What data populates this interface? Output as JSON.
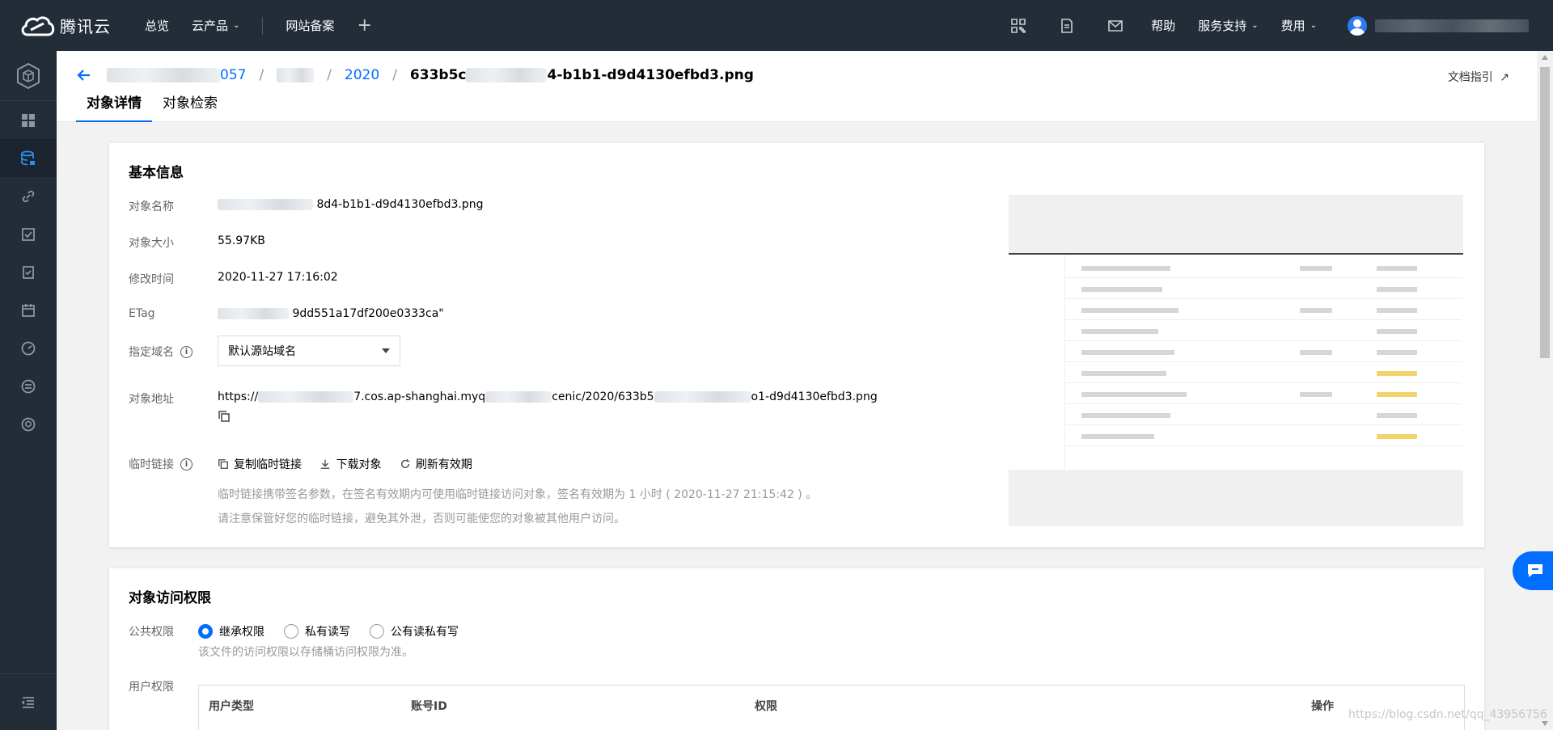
{
  "topnav": {
    "logo_text": "腾讯云",
    "items": [
      {
        "label": "总览"
      },
      {
        "label": "云产品",
        "dropdown": true
      },
      {
        "label": "网站备案"
      }
    ],
    "right_items": {
      "help": "帮助",
      "support": "服务支持",
      "fees": "费用"
    }
  },
  "header": {
    "breadcrumb": {
      "bucket_suffix": "057",
      "folder": "2020",
      "file_prefix": "633b5c",
      "file_suffix": "4-b1b1-d9d4130efbd3.png"
    },
    "doc_link": "文档指引",
    "tabs": [
      {
        "label": "对象详情",
        "active": true
      },
      {
        "label": "对象检索",
        "active": false
      }
    ]
  },
  "basic_info": {
    "title": "基本信息",
    "fields": {
      "name_label": "对象名称",
      "name_value": "8d4-b1b1-d9d4130efbd3.png",
      "size_label": "对象大小",
      "size_value": "55.97KB",
      "mtime_label": "修改时间",
      "mtime_value": "2020-11-27 17:16:02",
      "etag_label": "ETag",
      "etag_value": "9dd551a17df200e0333ca\"",
      "domain_label": "指定域名",
      "domain_value": "默认源站域名",
      "url_label": "对象地址",
      "url_part1": "https://",
      "url_part2": "7.cos.ap-shanghai.myq",
      "url_part3": "cenic/2020/633b5",
      "url_part4": "o1-d9d4130efbd3.png",
      "temp_label": "临时链接"
    },
    "actions": {
      "copy": "复制临时链接",
      "download": "下载对象",
      "refresh": "刷新有效期"
    },
    "hint1": "临时链接携带签名参数，在签名有效期内可使用临时链接访问对象，签名有效期为 1 小时 ( 2020-11-27 21:15:42 ) 。",
    "hint2": "请注意保管好您的临时链接，避免其外泄，否则可能使您的对象被其他用户访问。"
  },
  "access": {
    "title": "对象访问权限",
    "public_label": "公共权限",
    "options": [
      {
        "label": "继承权限",
        "selected": true
      },
      {
        "label": "私有读写",
        "selected": false
      },
      {
        "label": "公有读私有写",
        "selected": false
      }
    ],
    "public_hint": "该文件的访问权限以存储桶访问权限为准。",
    "user_label": "用户权限",
    "table_headers": {
      "type": "用户类型",
      "account": "账号ID",
      "perm": "权限",
      "op": "操作"
    }
  },
  "watermark": "https://blog.csdn.net/qq_43956756",
  "colors": {
    "nav_bg": "#232d38",
    "accent": "#006eff"
  }
}
